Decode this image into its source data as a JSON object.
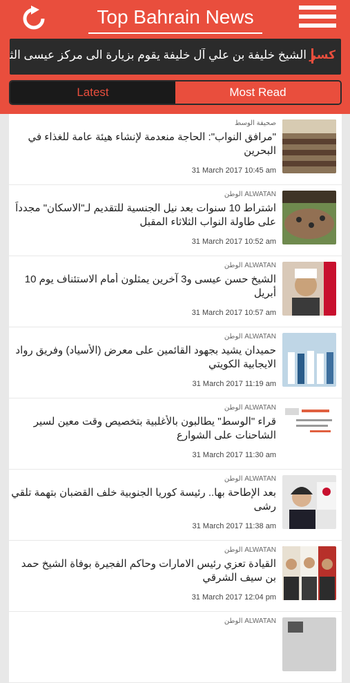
{
  "app": {
    "title": "Top Bahrain News"
  },
  "ticker": {
    "label": "كسر",
    "text": "الشيخ خليفة بن علي آل خليفة يقوم بزيارة الى مركز عيسى الثقافي -"
  },
  "tabs": [
    {
      "label": "Latest"
    },
    {
      "label": "Most Read"
    }
  ],
  "articles": [
    {
      "source": "صحيفة الوسط",
      "headline": "\"مرافق النواب\": الحاجة منعدمة لإنشاء هيئة عامة للغذاء في البحرين",
      "date": "31 March 2017 10:45 am",
      "thumb": "parliament-photo"
    },
    {
      "source": "الوطن ALWATAN",
      "headline": "اشتراط 10 سنوات بعد نيل الجنسية للتقديم لـ\"الاسكان\" مجدداً على طاولة النواب الثلاثاء المقبل",
      "date": "31 March 2017 10:52 am",
      "thumb": "parliament-photo"
    },
    {
      "source": "الوطن ALWATAN",
      "headline": "الشيخ حسن عيسى و3 آخرين يمثلون أمام الاستئناف يوم 10 أبريل",
      "date": "31 March 2017 10:57 am",
      "thumb": "portrait-photo"
    },
    {
      "source": "الوطن ALWATAN",
      "headline": "حميدان يشيد بجهود القائمين على معرض (الأسياد) وفريق رواد الايجابية الكويتي",
      "date": "31 March 2017 11:19 am",
      "thumb": "group-photo"
    },
    {
      "source": "الوطن ALWATAN",
      "headline": "قراء \"الوسط\" يطالبون بالأغلبية بتخصيص وقت معين لسير الشاحنات على الشوارع",
      "date": "31 March 2017 11:30 am",
      "thumb": "poll-screenshot"
    },
    {
      "source": "الوطن ALWATAN",
      "headline": "بعد الإطاحة بها.. رئيسة كوريا الجنوبية خلف القضبان بتهمة تلقي رشى",
      "date": "31 March 2017 11:38 am",
      "thumb": "portrait-photo"
    },
    {
      "source": "الوطن ALWATAN",
      "headline": "القيادة تعزي رئيس الامارات وحاكم الفجيرة بوفاة الشيخ حمد بن سيف الشرقي",
      "date": "31 March 2017 12:04 pm",
      "thumb": "leaders-photo"
    },
    {
      "source": "الوطن ALWATAN",
      "headline": "",
      "date": "",
      "thumb": "photo"
    }
  ]
}
